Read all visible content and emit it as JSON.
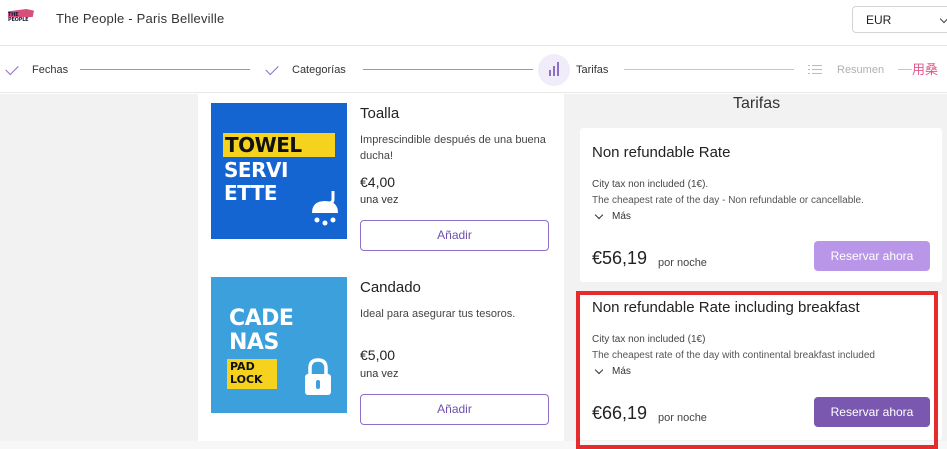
{
  "header": {
    "logo_text": "THE PEOPLE",
    "hotel_name": "The People - Paris Belleville",
    "currency": "EUR"
  },
  "stepper": {
    "steps": [
      {
        "label": "Fechas",
        "state": "done"
      },
      {
        "label": "Categorías",
        "state": "done"
      },
      {
        "label": "Tarifas",
        "state": "current"
      },
      {
        "label": "Resumen",
        "state": "pending"
      }
    ],
    "overflow_text": "用桑"
  },
  "products": [
    {
      "name": "Toalla",
      "description": "Imprescindible después de una buena ducha!",
      "image_text": [
        "TOWEL",
        "SERVI\nETTE"
      ],
      "price": "€4,00",
      "frequency": "una vez",
      "add_label": "Añadir"
    },
    {
      "name": "Candado",
      "description": "Ideal para asegurar tus tesoros.",
      "image_text": [
        "CADE\nNAS",
        "PAD\nLOCK"
      ],
      "price": "€5,00",
      "frequency": "una vez",
      "add_label": "Añadir"
    }
  ],
  "tarifas": {
    "title": "Tarifas",
    "rates": [
      {
        "name": "Non refundable Rate",
        "line1": "City tax non included (1€).",
        "line2": "The cheapest rate of the day - Non refundable or cancellable.",
        "more_label": "Más",
        "price": "€56,19",
        "per": "por noche",
        "button_label": "Reservar ahora"
      },
      {
        "name": "Non refundable Rate including breakfast",
        "line1": "City tax non included (1€)",
        "line2": "The cheapest rate of the day with continental breakfast included",
        "more_label": "Más",
        "price": "€66,19",
        "per": "por noche",
        "button_label": "Reservar ahora"
      }
    ]
  },
  "colors": {
    "accent": "#8e6fc7",
    "button_light": "#b996e8",
    "button_dark": "#7a58b0",
    "highlight": "#e52b2b",
    "towel_bg": "#1464d2",
    "padlock_bg": "#3ba0dc",
    "label_yellow": "#f5d21e"
  }
}
